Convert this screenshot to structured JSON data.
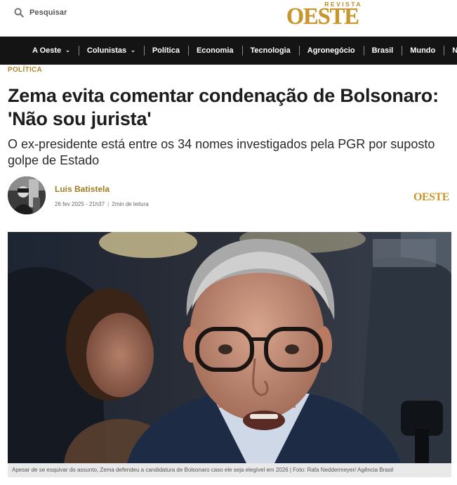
{
  "header": {
    "search_label": "Pesquisar",
    "logo_small": "REVISTA",
    "logo_big": "OESTE"
  },
  "nav": {
    "items": [
      {
        "label": "A Oeste",
        "dropdown": true
      },
      {
        "label": "Colunistas",
        "dropdown": true
      },
      {
        "label": "Política",
        "dropdown": false
      },
      {
        "label": "Economia",
        "dropdown": false
      },
      {
        "label": "Tecnologia",
        "dropdown": false
      },
      {
        "label": "Agronegócio",
        "dropdown": false
      },
      {
        "label": "Brasil",
        "dropdown": false
      },
      {
        "label": "Mundo",
        "dropdown": false
      },
      {
        "label": "N",
        "dropdown": false
      }
    ],
    "chevron_icon": "chevron-down-icon"
  },
  "article": {
    "category": "POLÍTICA",
    "title": "Zema evita comentar condenação de Bolsonaro: 'Não sou jurista'",
    "subtitle": "O ex-presidente está entre os 34 nomes investigados pela PGR por suposto golpe de Estado",
    "author": "Luis Batistela",
    "date": "26 fev 2025 - 21h37",
    "separator": "|",
    "read_time": "2min de leitura",
    "mini_logo": "OESTE",
    "caption": "Apesar de se esquivar do assunto, Zema defendeu a candidatura de Bolsonaro caso ele seja elegível em 2026 | Foto: Rafa Neddermeyer/ Agência Brasil"
  },
  "colors": {
    "brand_gold": "#c8962a",
    "nav_bg": "#141414",
    "category_gold": "#b08a2a"
  }
}
